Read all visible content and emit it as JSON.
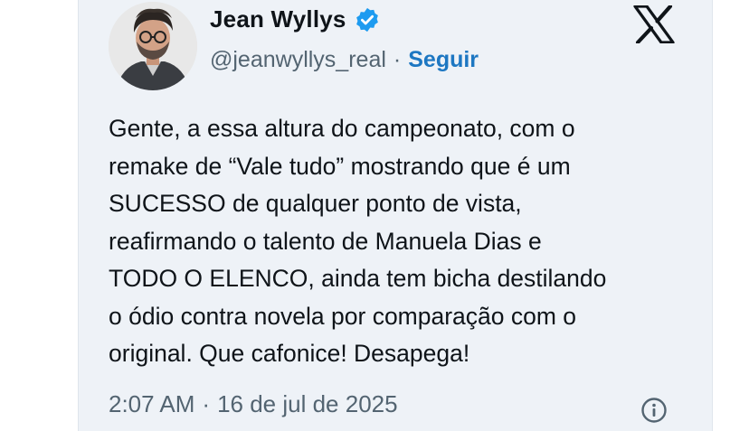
{
  "author": {
    "name": "Jean Wyllys",
    "handle": "@jeanwyllys_real",
    "follow_label": "Seguir",
    "verified": true,
    "verified_color": "#1d9bf0"
  },
  "platform_icon": "x-logo-icon",
  "tweet": {
    "lines": [
      "Gente, a essa altura do campeonato, com o",
      "remake de “Vale tudo” mostrando que é um",
      "SUCESSO de qualquer ponto de vista,",
      "reafirmando o talento de Manuela Dias e",
      "TODO O ELENCO, ainda tem bicha destilando",
      "o ódio contra novela por comparação com o",
      "original. Que cafonice! Desapega!"
    ]
  },
  "meta": {
    "time": "2:07 AM",
    "separator": "·",
    "date": "16 de jul de 2025"
  },
  "colors": {
    "card_bg": "#eef2f7",
    "text": "#0f1419",
    "secondary": "#536471",
    "link": "#1d77c2"
  }
}
